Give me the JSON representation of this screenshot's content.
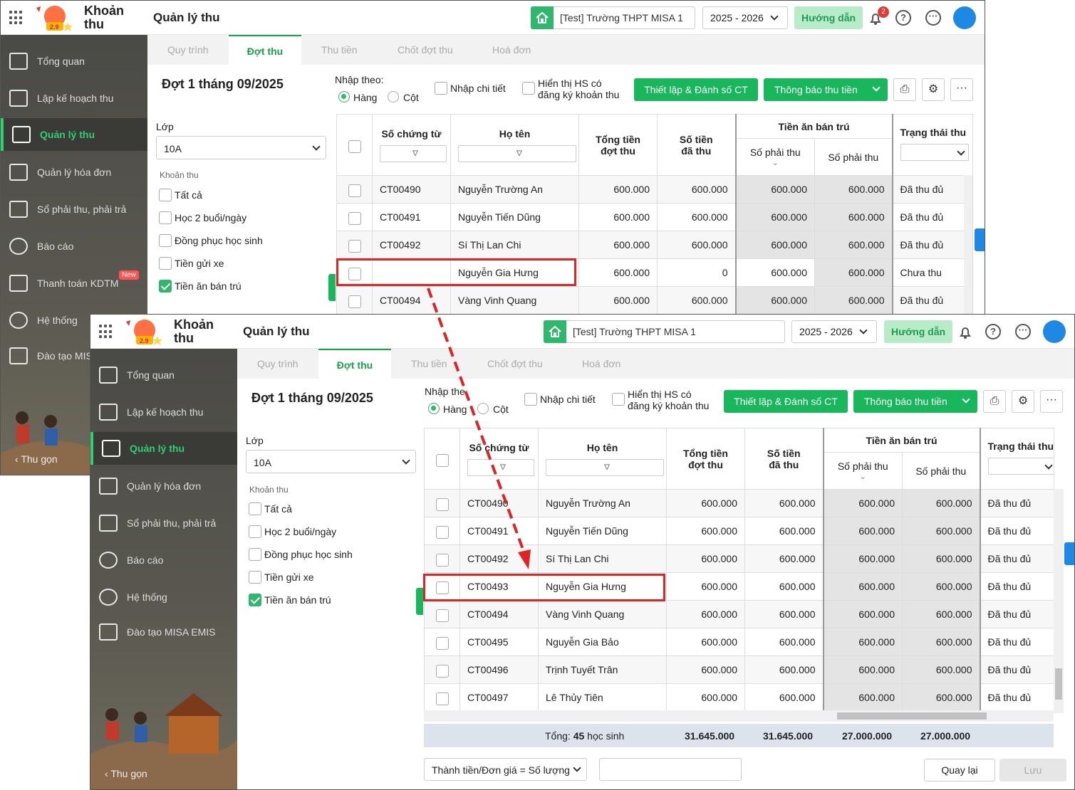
{
  "app": {
    "name_line1": "Khoản",
    "name_line2": "thu",
    "page_title": "Quản lý thu",
    "logo_text": "2.9"
  },
  "header": {
    "school": "[Test] Trường THPT MISA 1",
    "year": "2025 - 2026",
    "guide": "Hướng dẫn",
    "notif_count": "2",
    "help": "?",
    "more": "···"
  },
  "sidebar": {
    "items": [
      {
        "label": "Tổng quan",
        "icon": "chart-bar-icon"
      },
      {
        "label": "Lập kế hoạch thu",
        "icon": "calendar-dollar-icon"
      },
      {
        "label": "Quản lý thu",
        "icon": "hand-coin-icon"
      },
      {
        "label": "Quản lý hóa đơn",
        "icon": "invoice-icon"
      },
      {
        "label": "Sổ phải thu, phải trả",
        "icon": "book-icon"
      },
      {
        "label": "Báo cáo",
        "icon": "pie-chart-icon"
      },
      {
        "label": "Thanh toán KDTM",
        "icon": "card-icon"
      },
      {
        "label": "Hệ thống",
        "icon": "gear-icon"
      },
      {
        "label": "Đào tạo MISA EMIS",
        "icon": "open-book-icon"
      }
    ],
    "w1_training_label": "Đào tạo MIS",
    "new_badge": "New",
    "collapse": "Thu gọn"
  },
  "tabs": [
    "Quy trình",
    "Đợt thu",
    "Thu tiền",
    "Chốt đợt thu",
    "Hoá đơn"
  ],
  "main": {
    "title": "Đợt 1 tháng 09/2025",
    "class_label": "Lớp",
    "class_value": "10A",
    "fee_label": "Khoản thu",
    "fees": [
      {
        "label": "Tất cả",
        "checked": false
      },
      {
        "label": "Học 2 buổi/ngày",
        "checked": false
      },
      {
        "label": "Đồng phục học sinh",
        "checked": false
      },
      {
        "label": "Tiền gửi xe",
        "checked": false
      },
      {
        "label": "Tiền ăn bán trú",
        "checked": true
      }
    ],
    "input_by": "Nhập theo:",
    "input_by_w2": "Nhập the",
    "row_opt": "Hàng",
    "col_opt": "Cột",
    "detail": "Nhập chi tiết",
    "show_hs_1": "Hiển thị HS có",
    "show_hs_2": "đăng ký khoản thu",
    "btn_setup": "Thiết lập & Đánh số CT",
    "btn_notify": "Thông báo thu tiền"
  },
  "table": {
    "headers": {
      "voucher": "Số chứng từ",
      "name": "Họ tên",
      "total_1": "Tổng tiền",
      "total_2": "đợt thu",
      "paid_1": "Số tiền",
      "paid_2": "đã thu",
      "group": "Tiền ăn bán trú",
      "due_a": "Số phải thu",
      "due_b": "Số phải thu",
      "status": "Trạng thái thu"
    },
    "rows_w1": [
      {
        "voucher": "CT00490",
        "name": "Nguyễn Trường An",
        "total": "600.000",
        "paid": "600.000",
        "due_a": "600.000",
        "due_b": "600.000",
        "status": "Đã thu đủ"
      },
      {
        "voucher": "CT00491",
        "name": "Nguyễn Tiến Dũng",
        "total": "600.000",
        "paid": "600.000",
        "due_a": "600.000",
        "due_b": "600.000",
        "status": "Đã thu đủ"
      },
      {
        "voucher": "CT00492",
        "name": "Sí Thị Lan Chi",
        "total": "600.000",
        "paid": "600.000",
        "due_a": "600.000",
        "due_b": "600.000",
        "status": "Đã thu đủ"
      },
      {
        "voucher": "",
        "name": "Nguyễn Gia Hưng",
        "total": "600.000",
        "paid": "0",
        "due_a": "600.000",
        "due_b": "600.000",
        "status": "Chưa thu"
      },
      {
        "voucher": "CT00494",
        "name": "Vàng Vinh Quang",
        "total": "600.000",
        "paid": "600.000",
        "due_a": "600.000",
        "due_b": "600.000",
        "status": "Đã thu đủ"
      }
    ],
    "rows_w2": [
      {
        "voucher": "CT00490",
        "name": "Nguyễn Trường An",
        "total": "600.000",
        "paid": "600.000",
        "due_a": "600.000",
        "due_b": "600.000",
        "status": "Đã thu đủ"
      },
      {
        "voucher": "CT00491",
        "name": "Nguyễn Tiến Dũng",
        "total": "600.000",
        "paid": "600.000",
        "due_a": "600.000",
        "due_b": "600.000",
        "status": "Đã thu đủ"
      },
      {
        "voucher": "CT00492",
        "name": "Sí Thị Lan Chi",
        "total": "600.000",
        "paid": "600.000",
        "due_a": "600.000",
        "due_b": "600.000",
        "status": "Đã thu đủ"
      },
      {
        "voucher": "CT00493",
        "name": "Nguyễn Gia Hưng",
        "total": "600.000",
        "paid": "600.000",
        "due_a": "600.000",
        "due_b": "600.000",
        "status": "Đã thu đủ"
      },
      {
        "voucher": "CT00494",
        "name": "Vàng Vinh Quang",
        "total": "600.000",
        "paid": "600.000",
        "due_a": "600.000",
        "due_b": "600.000",
        "status": "Đã thu đủ"
      },
      {
        "voucher": "CT00495",
        "name": "Nguyễn Gia Bảo",
        "total": "600.000",
        "paid": "600.000",
        "due_a": "600.000",
        "due_b": "600.000",
        "status": "Đã thu đủ"
      },
      {
        "voucher": "CT00496",
        "name": "Trịnh Tuyết Trân",
        "total": "600.000",
        "paid": "600.000",
        "due_a": "600.000",
        "due_b": "600.000",
        "status": "Đã thu đủ"
      },
      {
        "voucher": "CT00497",
        "name": "Lê Thủy Tiên",
        "total": "600.000",
        "paid": "600.000",
        "due_a": "600.000",
        "due_b": "600.000",
        "status": "Đã thu đủ"
      }
    ],
    "footer": {
      "label": "Tổng:",
      "count": "45",
      "unit": "học sinh",
      "total": "31.645.000",
      "paid": "31.645.000",
      "due_a": "27.000.000",
      "due_b": "27.000.000"
    }
  },
  "bottom": {
    "formula": "Thành tiền/Đơn giá = Số lượng",
    "back": "Quay lại",
    "save": "Lưu"
  },
  "colors": {
    "accent": "#19b75c",
    "highlight": "#e02424",
    "sidebar": "#4a4a46"
  }
}
